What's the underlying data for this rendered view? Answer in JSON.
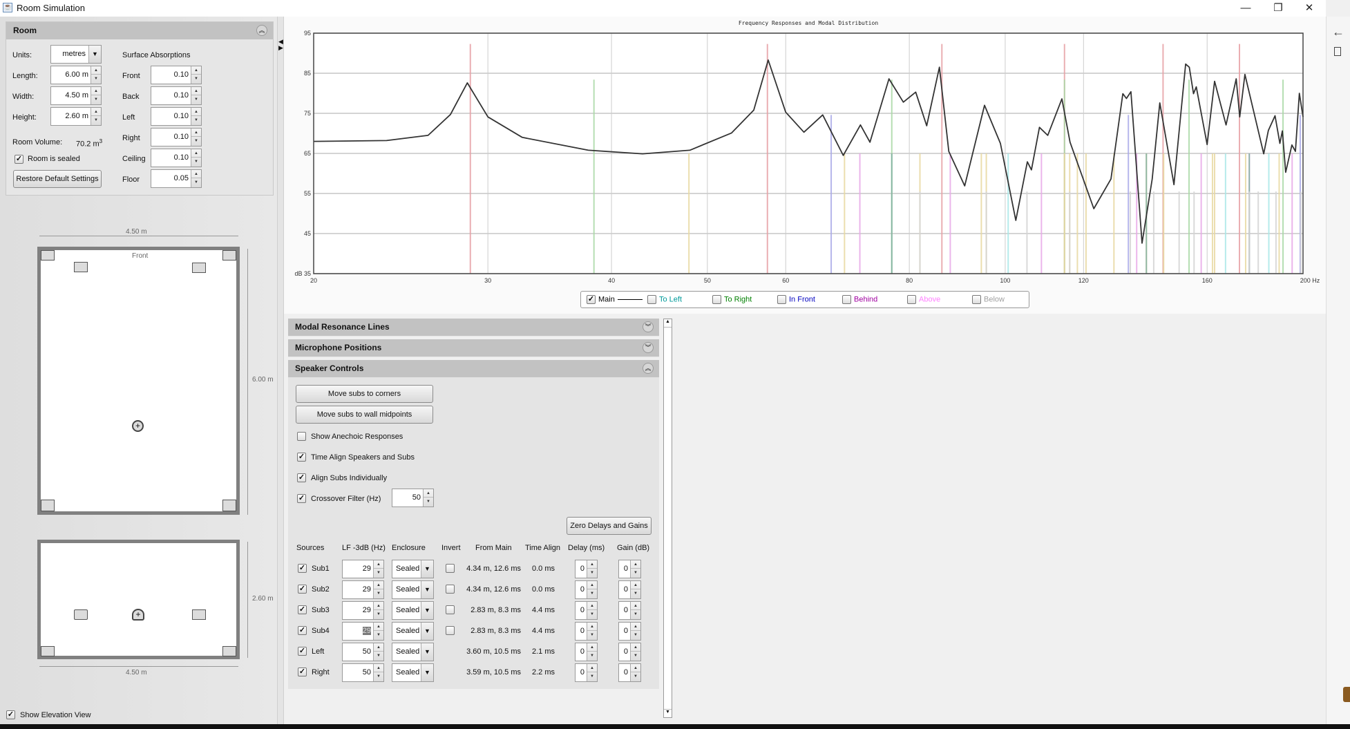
{
  "window": {
    "title": "Room Simulation",
    "minimize": "—",
    "restore": "❐",
    "close": "✕"
  },
  "room_panel": {
    "title": "Room",
    "units_label": "Units:",
    "units_value": "metres",
    "dimensions": [
      {
        "label": "Length:",
        "value": "6.00 m"
      },
      {
        "label": "Width:",
        "value": "4.50 m"
      },
      {
        "label": "Height:",
        "value": "2.60 m"
      }
    ],
    "volume_label": "Room Volume:",
    "volume_value": "70.2 m",
    "volume_unit_sup": "3",
    "sealed_label": "Room is sealed",
    "sealed_checked": true,
    "restore_button": "Restore Default Settings",
    "absorptions_title": "Surface Absorptions",
    "absorptions": [
      {
        "label": "Front",
        "value": "0.10"
      },
      {
        "label": "Back",
        "value": "0.10"
      },
      {
        "label": "Left",
        "value": "0.10"
      },
      {
        "label": "Right",
        "value": "0.10"
      },
      {
        "label": "Ceiling",
        "value": "0.10"
      },
      {
        "label": "Floor",
        "value": "0.05"
      }
    ]
  },
  "plan_view": {
    "width_label": "4.50 m",
    "length_label": "6.00 m",
    "front_label": "Front"
  },
  "elevation_view": {
    "height_label": "2.60 m",
    "width_label": "4.50 m"
  },
  "show_elevation": {
    "label": "Show Elevation View",
    "checked": true
  },
  "chart_data": {
    "type": "line",
    "title": "Frequency Responses and Modal Distribution",
    "xlabel": "Hz",
    "ylabel": "dB",
    "x_scale": "log",
    "xlim": [
      20,
      200
    ],
    "ylim": [
      35,
      95
    ],
    "grid": true,
    "x_ticks": [
      20,
      30,
      40,
      50,
      60,
      80,
      100,
      120,
      160,
      200
    ],
    "x_tick_labels": [
      "20",
      "30",
      "40",
      "50",
      "60",
      "80",
      "100",
      "120",
      "160",
      "200 Hz"
    ],
    "y_ticks": [
      35,
      45,
      55,
      65,
      75,
      85,
      95
    ],
    "y_tick_labels": [
      "dB 35",
      "45",
      "55",
      "65",
      "75",
      "85",
      "95"
    ],
    "series": [
      {
        "name": "Main",
        "color": "#333333",
        "points": [
          [
            20,
            68.0
          ],
          [
            23.7,
            68.2
          ],
          [
            26.1,
            69.5
          ],
          [
            27.5,
            74.7
          ],
          [
            28.6,
            82.6
          ],
          [
            30,
            74.1
          ],
          [
            32.5,
            69.0
          ],
          [
            37.9,
            65.8
          ],
          [
            43.0,
            64.9
          ],
          [
            48.0,
            65.8
          ],
          [
            52.9,
            70.1
          ],
          [
            55.7,
            75.8
          ],
          [
            57.6,
            88.3
          ],
          [
            60.0,
            75.3
          ],
          [
            62.6,
            70.3
          ],
          [
            65.4,
            74.6
          ],
          [
            68.6,
            64.5
          ],
          [
            71.4,
            72.1
          ],
          [
            73.0,
            67.8
          ],
          [
            76.3,
            83.6
          ],
          [
            78.9,
            77.8
          ],
          [
            81.2,
            80.3
          ],
          [
            83.3,
            71.9
          ],
          [
            85.8,
            86.5
          ],
          [
            87.7,
            65.5
          ],
          [
            91.0,
            56.9
          ],
          [
            95.3,
            77.0
          ],
          [
            98.9,
            67.5
          ],
          [
            102.5,
            48.3
          ],
          [
            105.3,
            62.9
          ],
          [
            106.3,
            60.9
          ],
          [
            108.3,
            71.5
          ],
          [
            110.4,
            69.5
          ],
          [
            114.1,
            78.6
          ],
          [
            116.3,
            67.8
          ],
          [
            122.9,
            51.2
          ],
          [
            127.9,
            58.6
          ],
          [
            131.5,
            79.9
          ],
          [
            132.6,
            78.7
          ],
          [
            134.0,
            80.4
          ],
          [
            137.5,
            42.6
          ],
          [
            140.8,
            58.6
          ],
          [
            143.3,
            77.6
          ],
          [
            148.1,
            57.2
          ],
          [
            152.2,
            87.3
          ],
          [
            153.5,
            86.5
          ],
          [
            155.0,
            79.9
          ],
          [
            156.0,
            81.6
          ],
          [
            160.0,
            67.2
          ],
          [
            162.8,
            83.0
          ],
          [
            167.2,
            72.1
          ],
          [
            171.2,
            83.6
          ],
          [
            172.6,
            74.1
          ],
          [
            174.7,
            84.7
          ],
          [
            182.5,
            64.9
          ],
          [
            184.5,
            70.7
          ],
          [
            187.4,
            74.4
          ],
          [
            189.5,
            67.5
          ],
          [
            190.6,
            70.6
          ],
          [
            192.1,
            60.3
          ],
          [
            194.9,
            67.1
          ],
          [
            196.5,
            65.5
          ],
          [
            198.3,
            80.0
          ],
          [
            200,
            74.1
          ]
        ]
      }
    ],
    "modal_lines": [
      {
        "color": "#e6a0a4",
        "top_db": 92.3,
        "freqs": [
          28.8,
          57.5,
          86.3,
          114.8,
          144.4,
          172.5
        ]
      },
      {
        "color": "#a8d8a4",
        "top_db": 83.4,
        "freqs": [
          38.4,
          76.8,
          114.8,
          153.4,
          190.9
        ]
      },
      {
        "color": "#a8a8e8",
        "top_db": 74.6,
        "freqs": [
          66.7,
          133.2,
          198.7
        ]
      },
      {
        "color": "#e8d8a0",
        "top_db": 65,
        "freqs": [
          47.9,
          68.8,
          82,
          94.6,
          95.7,
          114.8,
          116.2,
          118.3,
          120.7,
          128.8,
          138.9,
          144.6,
          162,
          162.8,
          175,
          189.2
        ]
      },
      {
        "color": "#e8a8e8",
        "top_db": 65,
        "freqs": [
          71.3,
          88,
          108.8,
          135.8,
          157.8,
          176.5,
          195
        ]
      },
      {
        "color": "#a8e8e8",
        "top_db": 65,
        "freqs": [
          100.7,
          167,
          184.7
        ]
      },
      {
        "color": "#80b0a0",
        "top_db": 65,
        "freqs": [
          76.8,
          138.9,
          176.5
        ]
      },
      {
        "color": "#d4d4d4",
        "top_db": 55.5,
        "freqs": [
          82,
          95.7,
          105.2,
          116.2,
          133.8,
          141.3,
          149.9,
          155.2,
          176.5,
          180.2,
          187.8,
          199
        ]
      }
    ],
    "legend": [
      {
        "label": "Main",
        "checked": true,
        "color": "#000000"
      },
      {
        "label": "To Left",
        "checked": false,
        "color": "#009a9a"
      },
      {
        "label": "To Right",
        "checked": false,
        "color": "#008000"
      },
      {
        "label": "In Front",
        "checked": false,
        "color": "#0000c0"
      },
      {
        "label": "Behind",
        "checked": false,
        "color": "#a000a0"
      },
      {
        "label": "Above",
        "checked": false,
        "color": "#ff80ff"
      },
      {
        "label": "Below",
        "checked": false,
        "color": "#a0a0a0"
      }
    ],
    "legend_placement": "bottom"
  },
  "sections": {
    "modal": "Modal Resonance Lines",
    "mic": "Microphone Positions",
    "speaker": "Speaker Controls"
  },
  "speaker_controls": {
    "corners_button": "Move subs to corners",
    "midpoints_button": "Move subs to wall midpoints",
    "options": [
      {
        "label": "Show Anechoic Responses",
        "checked": false
      },
      {
        "label": "Time Align Speakers and Subs",
        "checked": true
      },
      {
        "label": "Align Subs Individually",
        "checked": true
      },
      {
        "label": "Crossover Filter (Hz)",
        "checked": true
      }
    ],
    "crossover_value": "50",
    "zero_button": "Zero Delays and Gains",
    "headers": [
      "Sources",
      "LF -3dB (Hz)",
      "Enclosure",
      "Invert",
      "From Main",
      "Time Align",
      "Delay (ms)",
      "Gain (dB)"
    ],
    "rows": [
      {
        "name": "Sub1",
        "checked": true,
        "lf": "29",
        "enclosure": "Sealed",
        "invert": false,
        "from_main": "4.34 m, 12.6 ms",
        "time_align": "0.0 ms",
        "delay": "0",
        "gain": "0"
      },
      {
        "name": "Sub2",
        "checked": true,
        "lf": "29",
        "enclosure": "Sealed",
        "invert": false,
        "from_main": "4.34 m, 12.6 ms",
        "time_align": "0.0 ms",
        "delay": "0",
        "gain": "0"
      },
      {
        "name": "Sub3",
        "checked": true,
        "lf": "29",
        "enclosure": "Sealed",
        "invert": false,
        "from_main": "2.83 m, 8.3 ms",
        "time_align": "4.4 ms",
        "delay": "0",
        "gain": "0"
      },
      {
        "name": "Sub4",
        "checked": true,
        "lf": "29",
        "enclosure": "Sealed",
        "invert": false,
        "from_main": "2.83 m, 8.3 ms",
        "time_align": "4.4 ms",
        "delay": "0",
        "gain": "0",
        "selected": true
      },
      {
        "name": "Left",
        "checked": true,
        "lf": "50",
        "enclosure": "Sealed",
        "from_main": "3.60 m, 10.5 ms",
        "time_align": "2.1 ms",
        "delay": "0",
        "gain": "0"
      },
      {
        "name": "Right",
        "checked": true,
        "lf": "50",
        "enclosure": "Sealed",
        "from_main": "3.59 m, 10.5 ms",
        "time_align": "2.2 ms",
        "delay": "0",
        "gain": "0"
      }
    ]
  },
  "right_strip": {
    "back_icon": "arrow-left-icon",
    "doc_icon": "document-icon"
  }
}
